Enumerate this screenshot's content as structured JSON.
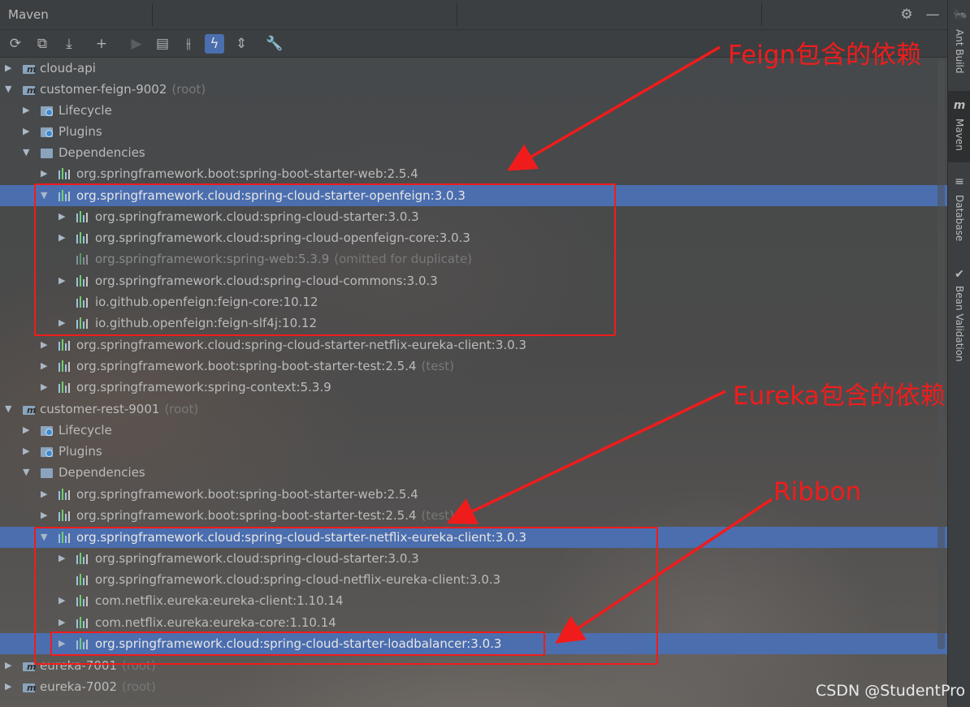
{
  "panel": {
    "title": "Maven"
  },
  "toolbar": {
    "buttons": [
      "reload-all",
      "reimport",
      "download",
      "add",
      "run",
      "execute-goal",
      "toggle-offline",
      "skip-tests",
      "collapse-all",
      "settings"
    ]
  },
  "side_tabs": [
    "Ant Build",
    "Maven",
    "Database",
    "Bean Validation"
  ],
  "tree": [
    {
      "label": "cloud-api",
      "suffix": ""
    },
    {
      "label": "customer-feign-9002",
      "suffix": "(root)"
    },
    {
      "label": "Lifecycle",
      "suffix": ""
    },
    {
      "label": "Plugins",
      "suffix": ""
    },
    {
      "label": "Dependencies",
      "suffix": ""
    },
    {
      "label": "org.springframework.boot:spring-boot-starter-web:2.5.4",
      "suffix": ""
    },
    {
      "label": "org.springframework.cloud:spring-cloud-starter-openfeign:3.0.3",
      "suffix": ""
    },
    {
      "label": "org.springframework.cloud:spring-cloud-starter:3.0.3",
      "suffix": ""
    },
    {
      "label": "org.springframework.cloud:spring-cloud-openfeign-core:3.0.3",
      "suffix": ""
    },
    {
      "label": "org.springframework:spring-web:5.3.9",
      "suffix": "(omitted for duplicate)"
    },
    {
      "label": "org.springframework.cloud:spring-cloud-commons:3.0.3",
      "suffix": ""
    },
    {
      "label": "io.github.openfeign:feign-core:10.12",
      "suffix": ""
    },
    {
      "label": "io.github.openfeign:feign-slf4j:10.12",
      "suffix": ""
    },
    {
      "label": "org.springframework.cloud:spring-cloud-starter-netflix-eureka-client:3.0.3",
      "suffix": ""
    },
    {
      "label": "org.springframework.boot:spring-boot-starter-test:2.5.4",
      "suffix": "(test)"
    },
    {
      "label": "org.springframework:spring-context:5.3.9",
      "suffix": ""
    },
    {
      "label": "customer-rest-9001",
      "suffix": "(root)"
    },
    {
      "label": "Lifecycle",
      "suffix": ""
    },
    {
      "label": "Plugins",
      "suffix": ""
    },
    {
      "label": "Dependencies",
      "suffix": ""
    },
    {
      "label": "org.springframework.boot:spring-boot-starter-web:2.5.4",
      "suffix": ""
    },
    {
      "label": "org.springframework.boot:spring-boot-starter-test:2.5.4",
      "suffix": "(test)"
    },
    {
      "label": "org.springframework.cloud:spring-cloud-starter-netflix-eureka-client:3.0.3",
      "suffix": ""
    },
    {
      "label": "org.springframework.cloud:spring-cloud-starter:3.0.3",
      "suffix": ""
    },
    {
      "label": "org.springframework.cloud:spring-cloud-netflix-eureka-client:3.0.3",
      "suffix": ""
    },
    {
      "label": "com.netflix.eureka:eureka-client:1.10.14",
      "suffix": ""
    },
    {
      "label": "com.netflix.eureka:eureka-core:1.10.14",
      "suffix": ""
    },
    {
      "label": "org.springframework.cloud:spring-cloud-starter-loadbalancer:3.0.3",
      "suffix": ""
    },
    {
      "label": "eureka-7001",
      "suffix": "(root)"
    },
    {
      "label": "eureka-7002",
      "suffix": "(root)"
    }
  ],
  "annotations": {
    "feign": "Feign包含的依赖",
    "eureka": "Eureka包含的依赖",
    "ribbon": "Ribbon"
  },
  "watermark": "CSDN @StudentPro",
  "colors": {
    "selection": "#4b6eaf",
    "annotation": "#f01c1c",
    "panel": "#3c3f41"
  }
}
